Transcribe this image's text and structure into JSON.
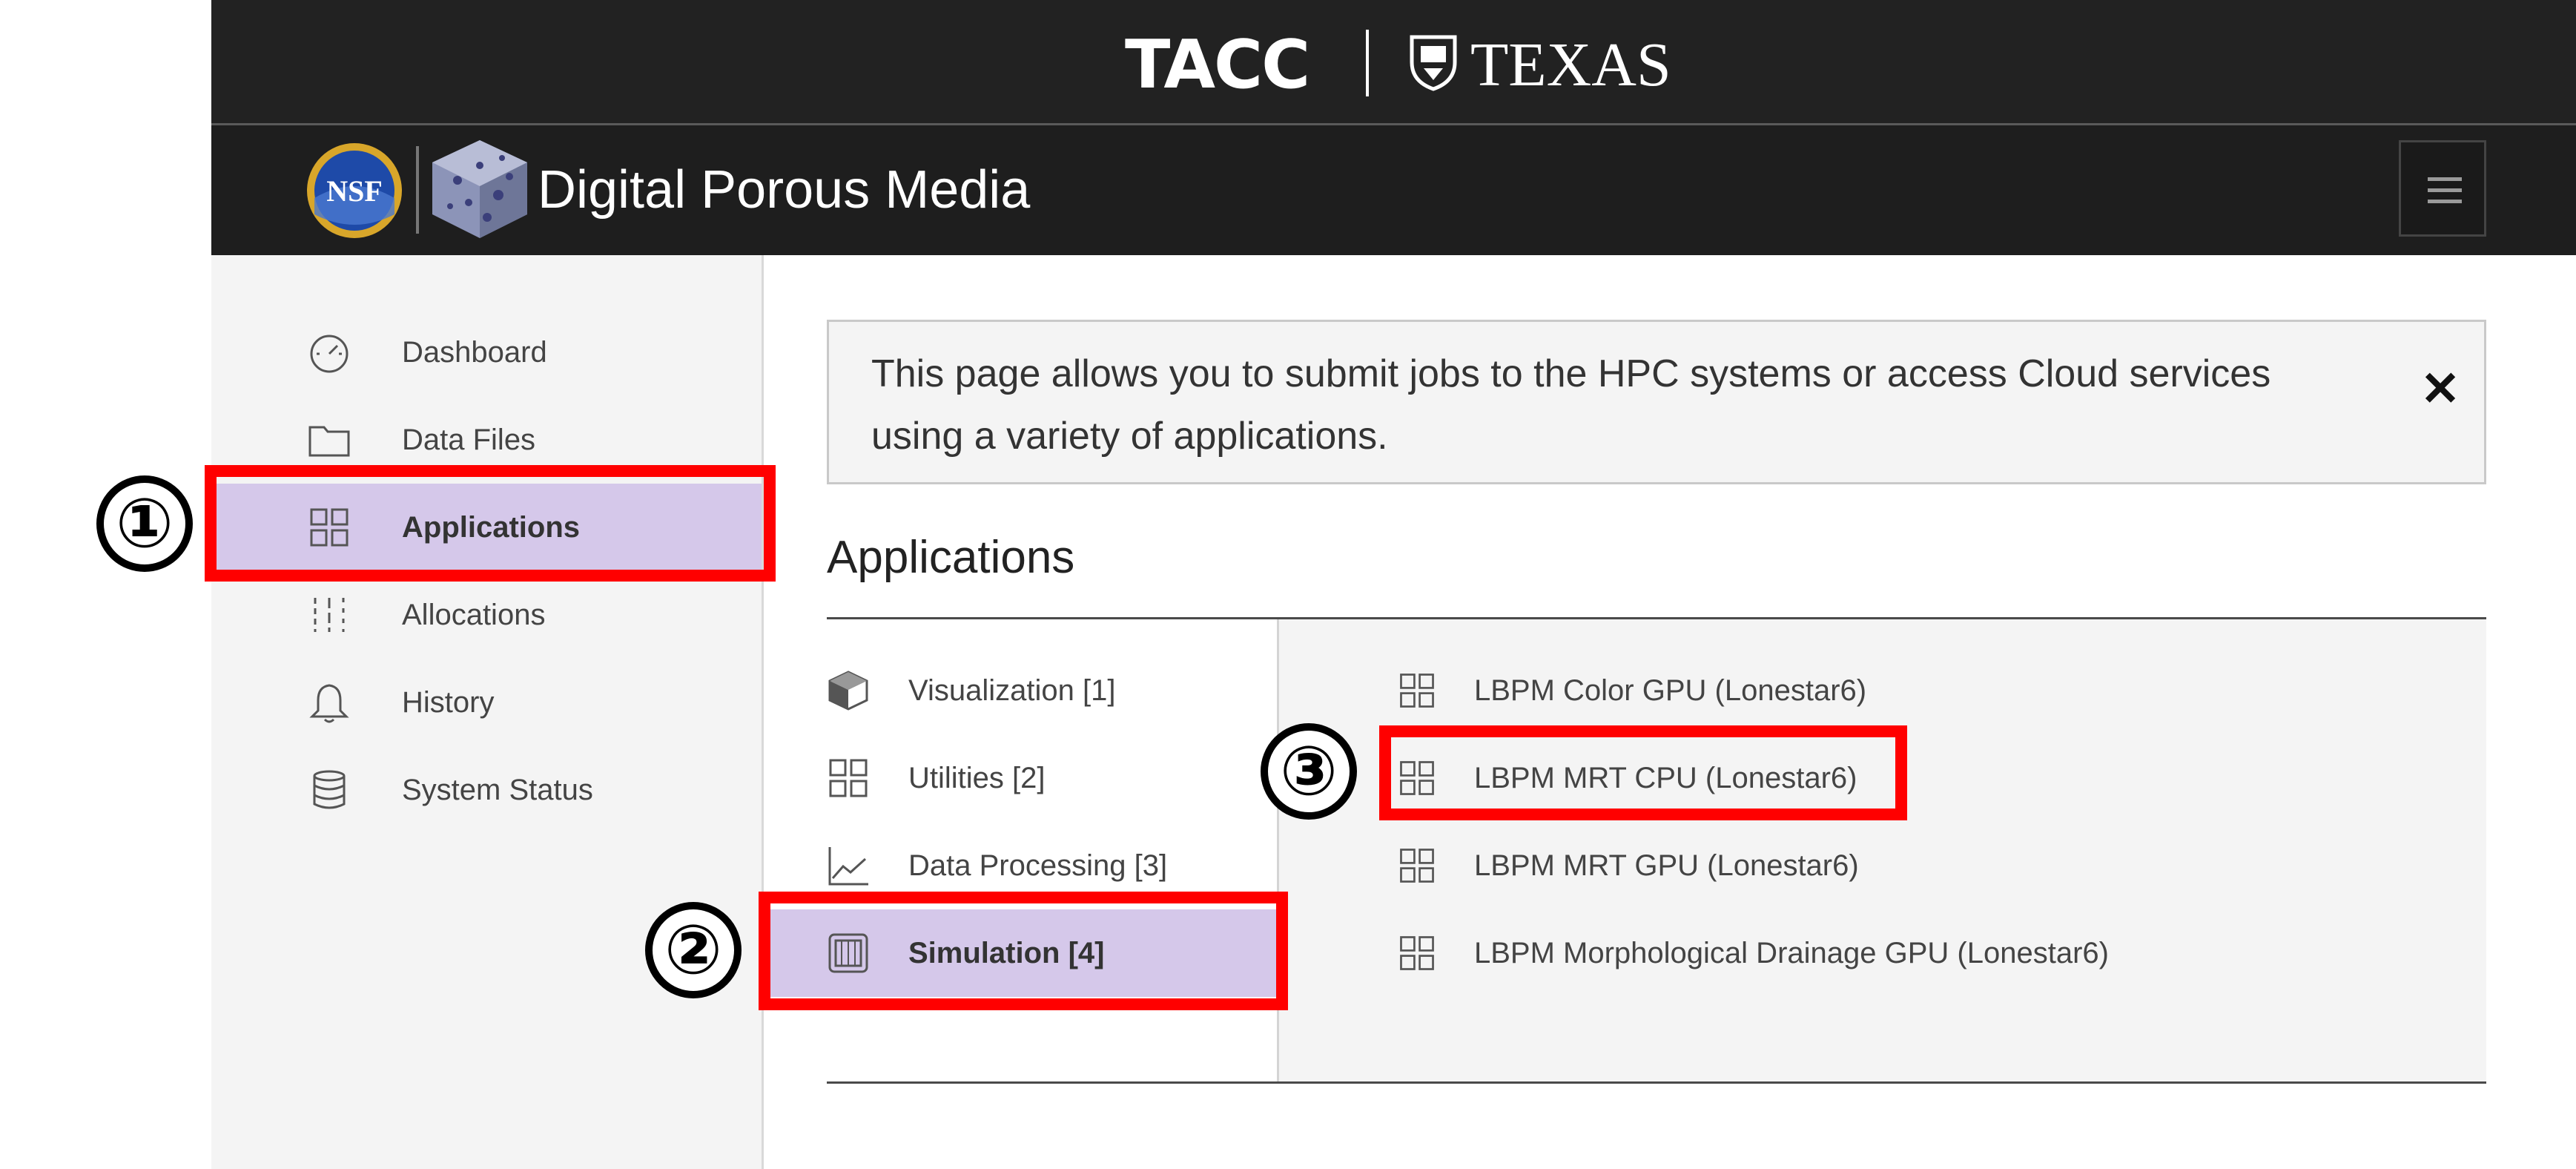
{
  "header": {
    "tacc_logo_text": "TACC",
    "texas_logo_text": "TEXAS",
    "nsf_logo_text": "NSF",
    "app_title": "Digital Porous Media",
    "menu_icon": "hamburger-menu-icon"
  },
  "sidebar": {
    "items": [
      {
        "label": "Dashboard",
        "icon": "speedometer-icon",
        "active": false
      },
      {
        "label": "Data Files",
        "icon": "folder-icon",
        "active": false
      },
      {
        "label": "Applications",
        "icon": "grid-icon",
        "active": true
      },
      {
        "label": "Allocations",
        "icon": "sliders-icon",
        "active": false
      },
      {
        "label": "History",
        "icon": "bell-icon",
        "active": false
      },
      {
        "label": "System Status",
        "icon": "database-icon",
        "active": false
      }
    ]
  },
  "banner": {
    "text": "This page allows you to submit jobs to the HPC systems or access Cloud services using a variety of applications.",
    "close_label": "✕"
  },
  "main": {
    "section_title": "Applications",
    "categories": [
      {
        "label": "Visualization [1]",
        "icon": "cube-icon",
        "active": false
      },
      {
        "label": "Utilities [2]",
        "icon": "grid-icon",
        "active": false
      },
      {
        "label": "Data Processing [3]",
        "icon": "line-chart-icon",
        "active": false
      },
      {
        "label": "Simulation [4]",
        "icon": "chip-icon",
        "active": true
      }
    ],
    "apps": [
      {
        "label": "LBPM Color GPU (Lonestar6)",
        "icon": "grid-icon"
      },
      {
        "label": "LBPM MRT CPU (Lonestar6)",
        "icon": "grid-icon"
      },
      {
        "label": "LBPM MRT GPU (Lonestar6)",
        "icon": "grid-icon"
      },
      {
        "label": "LBPM Morphological Drainage GPU (Lonestar6)",
        "icon": "grid-icon"
      }
    ]
  },
  "annotations": {
    "step1": "①",
    "step2": "②",
    "step3": "③",
    "highlight_color": "#ff0000"
  },
  "colors": {
    "header_bg": "#222222",
    "active_bg": "#d5c8ea",
    "sidebar_bg": "#f4f4f4"
  }
}
